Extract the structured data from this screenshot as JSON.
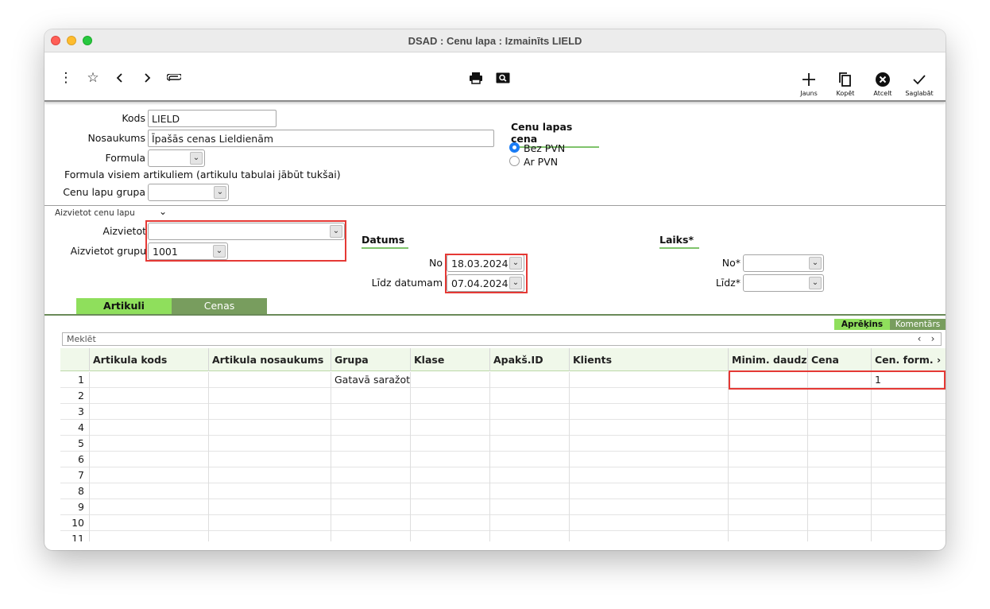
{
  "window": {
    "title": "DSAD : Cenu lapa : Izmainīts LIELD"
  },
  "toolbar": {
    "right_buttons": [
      {
        "label": "Jauns",
        "icon": "plus-icon"
      },
      {
        "label": "Kopēt",
        "icon": "copy-icon"
      },
      {
        "label": "Atcelt",
        "icon": "cancel-icon"
      },
      {
        "label": "Saglabāt",
        "icon": "checkmark-icon"
      }
    ]
  },
  "form": {
    "kods_label": "Kods",
    "kods_value": "LIELD",
    "nosaukums_label": "Nosaukums",
    "nosaukums_value": "Īpašās cenas Lieldienām",
    "formula_label": "Formula",
    "formula_value": "",
    "formula_note": "Formula visiem artikuliem (artikulu tabulai jābūt tukšai)",
    "grupa_label": "Cenu lapu grupa",
    "grupa_value": ""
  },
  "price_type": {
    "header": "Cenu lapas cena",
    "options": [
      {
        "label": "Bez PVN",
        "selected": true
      },
      {
        "label": "Ar PVN",
        "selected": false
      }
    ]
  },
  "replace": {
    "section_label": "Aizvietot cenu lapu",
    "aizvietot_label": "Aizvietot",
    "aizvietot_value": "",
    "grupu_label": "Aizvietot grupu",
    "grupu_value": "1001"
  },
  "dates": {
    "header": "Datums",
    "no_label": "No",
    "no_value": "18.03.2024",
    "lidz_label": "Līdz datumam",
    "lidz_value": "07.04.2024"
  },
  "time": {
    "header": "Laiks*",
    "no_label": "No*",
    "no_value": "",
    "lidz_label": "Līdz*",
    "lidz_value": ""
  },
  "tabs": [
    {
      "label": "Artikuli",
      "active": true
    },
    {
      "label": "Cenas",
      "active": false
    }
  ],
  "subtabs": [
    {
      "label": "Aprēķins",
      "active": true
    },
    {
      "label": "Komentārs",
      "active": false
    }
  ],
  "search_placeholder": "Meklēt",
  "table": {
    "columns": [
      "",
      "Artikula kods",
      "Artikula nosaukums",
      "Grupa",
      "Klase",
      "Apakš.ID",
      "Klients",
      "Minim. daudz.",
      "Cena",
      "Cen. form."
    ],
    "rows": [
      [
        "1",
        "",
        "",
        "Gatavā saražotā",
        "",
        "",
        "",
        "",
        "",
        "1"
      ],
      [
        "2",
        "",
        "",
        "",
        "",
        "",
        "",
        "",
        "",
        ""
      ],
      [
        "3",
        "",
        "",
        "",
        "",
        "",
        "",
        "",
        "",
        ""
      ],
      [
        "4",
        "",
        "",
        "",
        "",
        "",
        "",
        "",
        "",
        ""
      ],
      [
        "5",
        "",
        "",
        "",
        "",
        "",
        "",
        "",
        "",
        ""
      ],
      [
        "6",
        "",
        "",
        "",
        "",
        "",
        "",
        "",
        "",
        ""
      ],
      [
        "7",
        "",
        "",
        "",
        "",
        "",
        "",
        "",
        "",
        ""
      ],
      [
        "8",
        "",
        "",
        "",
        "",
        "",
        "",
        "",
        "",
        ""
      ],
      [
        "9",
        "",
        "",
        "",
        "",
        "",
        "",
        "",
        "",
        ""
      ],
      [
        "10",
        "",
        "",
        "",
        "",
        "",
        "",
        "",
        "",
        ""
      ],
      [
        "11",
        "",
        "",
        "",
        "",
        "",
        "",
        "",
        "",
        ""
      ]
    ]
  },
  "colors": {
    "tab_active": "#8fdf5c",
    "tab_inactive": "#789d5e",
    "highlight": "#e53935",
    "radio_selected": "#1a7cf5"
  }
}
